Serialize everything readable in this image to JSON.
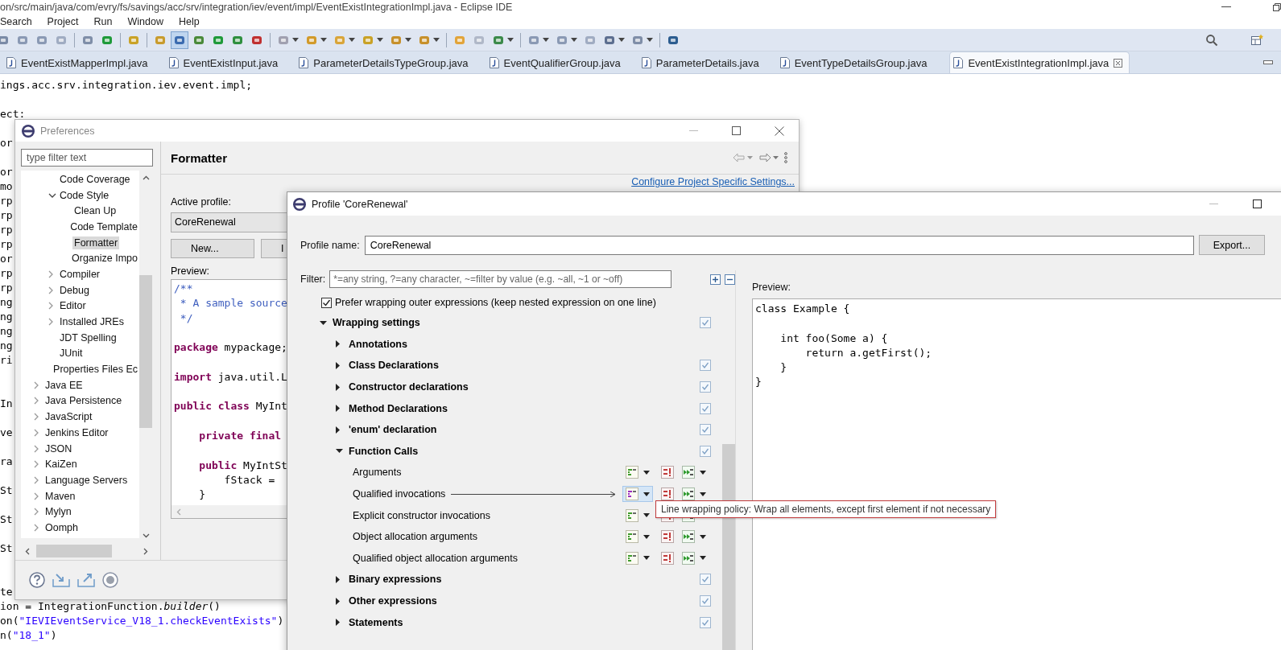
{
  "window": {
    "title": "on/src/main/java/com/evry/fs/savings/acc/srv/integration/iev/event/impl/EventExistIntegrationImpl.java - Eclipse IDE"
  },
  "menu": [
    "Search",
    "Project",
    "Run",
    "Window",
    "Help"
  ],
  "toolbar": [
    {
      "kind": "button",
      "pressed": false
    },
    {
      "kind": "button",
      "pressed": false
    },
    {
      "kind": "button",
      "pressed": false
    },
    {
      "kind": "button",
      "pressed": false
    },
    {
      "kind": "separator"
    },
    {
      "kind": "button",
      "pressed": false
    },
    {
      "kind": "button",
      "pressed": false
    },
    {
      "kind": "separator"
    },
    {
      "kind": "button",
      "pressed": false
    },
    {
      "kind": "separator"
    },
    {
      "kind": "button",
      "pressed": false
    },
    {
      "kind": "button",
      "pressed": true
    },
    {
      "kind": "button",
      "pressed": false
    },
    {
      "kind": "button",
      "pressed": false
    },
    {
      "kind": "button",
      "pressed": false
    },
    {
      "kind": "button",
      "pressed": false
    },
    {
      "kind": "separator"
    },
    {
      "kind": "menu-button",
      "pressed": false
    },
    {
      "kind": "menu-button",
      "pressed": false
    },
    {
      "kind": "menu-button",
      "pressed": false
    },
    {
      "kind": "menu-button",
      "pressed": false
    },
    {
      "kind": "menu-button",
      "pressed": false
    },
    {
      "kind": "menu-button",
      "pressed": false
    },
    {
      "kind": "separator"
    },
    {
      "kind": "button",
      "pressed": false
    },
    {
      "kind": "button",
      "pressed": false
    },
    {
      "kind": "menu-button",
      "pressed": false
    },
    {
      "kind": "separator"
    },
    {
      "kind": "menu-button",
      "pressed": false
    },
    {
      "kind": "menu-button",
      "pressed": false
    },
    {
      "kind": "button",
      "pressed": false
    },
    {
      "kind": "menu-button",
      "pressed": false
    },
    {
      "kind": "menu-button",
      "pressed": false
    },
    {
      "kind": "separator"
    },
    {
      "kind": "button",
      "pressed": false
    }
  ],
  "tabs": [
    {
      "label": "EventExistMapperImpl.java",
      "selected": false
    },
    {
      "label": "EventExistInput.java",
      "selected": false
    },
    {
      "label": "ParameterDetailsTypeGroup.java",
      "selected": false
    },
    {
      "label": "EventQualifierGroup.java",
      "selected": false
    },
    {
      "label": "ParameterDetails.java",
      "selected": false
    },
    {
      "label": "EventTypeDetailsGroup.java",
      "selected": false
    },
    {
      "label": "EventExistIntegrationImpl.java",
      "selected": true
    }
  ],
  "editor": {
    "lines": [
      {
        "kind": "code",
        "parts": [
          {
            "kind": "plain",
            "text": "ings.acc.srv.integration.iev.event.impl;"
          }
        ]
      },
      {
        "kind": "blank"
      },
      {
        "kind": "code",
        "parts": [
          {
            "kind": "plain",
            "text": "ect:"
          }
        ]
      },
      {
        "kind": "blank"
      },
      {
        "kind": "code",
        "parts": [
          {
            "kind": "plain",
            "text": "or"
          }
        ]
      },
      {
        "kind": "blank"
      },
      {
        "kind": "code",
        "parts": [
          {
            "kind": "plain",
            "text": "or"
          }
        ]
      },
      {
        "kind": "code",
        "parts": [
          {
            "kind": "plain",
            "text": "mo"
          }
        ]
      },
      {
        "kind": "code",
        "parts": [
          {
            "kind": "plain",
            "text": "rp"
          }
        ]
      },
      {
        "kind": "code",
        "parts": [
          {
            "kind": "plain",
            "text": "rp"
          }
        ]
      },
      {
        "kind": "code",
        "parts": [
          {
            "kind": "plain",
            "text": "rp"
          }
        ]
      },
      {
        "kind": "code",
        "parts": [
          {
            "kind": "plain",
            "text": "rp"
          }
        ]
      },
      {
        "kind": "code",
        "parts": [
          {
            "kind": "plain",
            "text": "or"
          }
        ]
      },
      {
        "kind": "code",
        "parts": [
          {
            "kind": "plain",
            "text": "rp"
          }
        ]
      },
      {
        "kind": "code",
        "parts": [
          {
            "kind": "plain",
            "text": "rp"
          }
        ]
      },
      {
        "kind": "code",
        "parts": [
          {
            "kind": "plain",
            "text": "ng"
          }
        ]
      },
      {
        "kind": "code",
        "parts": [
          {
            "kind": "plain",
            "text": "ng"
          }
        ]
      },
      {
        "kind": "code",
        "parts": [
          {
            "kind": "plain",
            "text": "ng"
          }
        ]
      },
      {
        "kind": "code",
        "parts": [
          {
            "kind": "plain",
            "text": "ng"
          }
        ]
      },
      {
        "kind": "code",
        "parts": [
          {
            "kind": "plain",
            "text": "ri"
          }
        ]
      },
      {
        "kind": "blank"
      },
      {
        "kind": "blank"
      },
      {
        "kind": "code",
        "parts": [
          {
            "kind": "plain",
            "text": "In"
          }
        ]
      },
      {
        "kind": "blank"
      },
      {
        "kind": "code",
        "parts": [
          {
            "kind": "plain",
            "text": "ve"
          }
        ]
      },
      {
        "kind": "blank"
      },
      {
        "kind": "code",
        "parts": [
          {
            "kind": "plain",
            "text": "ra"
          }
        ]
      },
      {
        "kind": "blank"
      },
      {
        "kind": "code",
        "parts": [
          {
            "kind": "plain",
            "text": "St"
          }
        ]
      },
      {
        "kind": "blank"
      },
      {
        "kind": "code",
        "parts": [
          {
            "kind": "plain",
            "text": "St"
          }
        ]
      },
      {
        "kind": "blank"
      },
      {
        "kind": "code",
        "parts": [
          {
            "kind": "plain",
            "text": "St"
          }
        ]
      },
      {
        "kind": "blank"
      },
      {
        "kind": "blank"
      },
      {
        "kind": "code",
        "parts": [
          {
            "kind": "plain",
            "text": "te"
          }
        ]
      },
      {
        "kind": "code",
        "parts": [
          {
            "kind": "plain",
            "text": "ion = IntegrationFunction."
          },
          {
            "kind": "italic",
            "text": "builder"
          },
          {
            "kind": "plain",
            "text": "()"
          }
        ]
      },
      {
        "kind": "code",
        "parts": [
          {
            "kind": "plain",
            "text": "on("
          },
          {
            "kind": "string",
            "text": "\"IEVIEventService_V18_1.checkEventExists\""
          },
          {
            "kind": "plain",
            "text": ")"
          }
        ]
      },
      {
        "kind": "code",
        "parts": [
          {
            "kind": "plain",
            "text": "n("
          },
          {
            "kind": "string",
            "text": "\"18_1\""
          },
          {
            "kind": "plain",
            "text": ")"
          }
        ]
      }
    ]
  },
  "preferences": {
    "title": "Preferences",
    "filter_placeholder": "type filter text",
    "tree": [
      {
        "children": [
          {
            "label": "Code Coverage",
            "selected": false
          },
          {
            "label": "Code Style",
            "expanded": true,
            "selected": false,
            "children": [
              {
                "label": "Clean Up",
                "selected": false
              },
              {
                "label": "Code Template",
                "selected": false
              },
              {
                "label": "Formatter",
                "selected": true
              },
              {
                "label": "Organize Impo",
                "selected": false
              }
            ]
          },
          {
            "label": "Compiler",
            "expanded": false,
            "selected": false
          },
          {
            "label": "Debug",
            "expanded": false,
            "selected": false
          },
          {
            "label": "Editor",
            "expanded": false,
            "selected": false
          },
          {
            "label": "Installed JREs",
            "expanded": false,
            "selected": false
          },
          {
            "label": "JDT Spelling",
            "selected": false
          },
          {
            "label": "JUnit",
            "selected": false
          },
          {
            "label": "Properties Files Ec",
            "selected": false
          }
        ]
      },
      {
        "label": "Java EE",
        "expanded": false,
        "selected": false
      },
      {
        "label": "Java Persistence",
        "expanded": false,
        "selected": false
      },
      {
        "label": "JavaScript",
        "expanded": false,
        "selected": false
      },
      {
        "label": "Jenkins Editor",
        "expanded": false,
        "selected": false
      },
      {
        "label": "JSON",
        "expanded": false,
        "selected": false
      },
      {
        "label": "KaiZen",
        "expanded": false,
        "selected": false
      },
      {
        "label": "Language Servers",
        "expanded": false,
        "selected": false
      },
      {
        "label": "Maven",
        "expanded": false,
        "selected": false
      },
      {
        "label": "Mylyn",
        "expanded": false,
        "selected": false
      },
      {
        "label": "Oomph",
        "expanded": false,
        "selected": false
      }
    ],
    "page_title": "Formatter",
    "link": "Configure Project Specific Settings...",
    "active_profile_label": "Active profile:",
    "active_profile": "CoreRenewal",
    "buttons": [
      "New...",
      "I"
    ],
    "preview_label": "Preview:",
    "preview_lines": [
      {
        "kind": "code",
        "parts": [
          {
            "kind": "comment",
            "text": "/**"
          }
        ]
      },
      {
        "kind": "code",
        "parts": [
          {
            "kind": "comment",
            "text": " * A sample source"
          }
        ]
      },
      {
        "kind": "code",
        "parts": [
          {
            "kind": "comment",
            "text": " */"
          }
        ]
      },
      {
        "kind": "blank"
      },
      {
        "kind": "code",
        "parts": [
          {
            "kind": "keyword",
            "text": "package"
          },
          {
            "kind": "plain",
            "text": " mypackage;"
          }
        ]
      },
      {
        "kind": "blank"
      },
      {
        "kind": "code",
        "parts": [
          {
            "kind": "keyword",
            "text": "import"
          },
          {
            "kind": "plain",
            "text": " java.util.L"
          }
        ]
      },
      {
        "kind": "blank"
      },
      {
        "kind": "code",
        "parts": [
          {
            "kind": "keyword",
            "text": "public class"
          },
          {
            "kind": "plain",
            "text": " MyInt"
          }
        ]
      },
      {
        "kind": "blank"
      },
      {
        "kind": "code",
        "parts": [
          {
            "kind": "keyword",
            "text": "    private final"
          }
        ]
      },
      {
        "kind": "blank"
      },
      {
        "kind": "code",
        "parts": [
          {
            "kind": "keyword",
            "text": "    public"
          },
          {
            "kind": "plain",
            "text": " MyIntSt"
          }
        ]
      },
      {
        "kind": "code",
        "parts": [
          {
            "kind": "plain",
            "text": "        fStack ="
          }
        ]
      },
      {
        "kind": "code",
        "parts": [
          {
            "kind": "plain",
            "text": "    }"
          }
        ]
      }
    ]
  },
  "profile_dialog": {
    "title": "Profile 'CoreRenewal'",
    "name_label": "Profile name:",
    "name": "CoreRenewal",
    "export_button": "Export...",
    "filter_label": "Filter:",
    "filter_placeholder": "*=any string, ?=any character, ~=filter by value (e.g. ~all, ~1 or ~off)",
    "prefer_option": {
      "label": "Prefer wrapping outer expressions (keep nested expression on one line)",
      "checked": true
    },
    "settings": [
      {
        "kind": "group",
        "label": "Wrapping settings",
        "expanded": true,
        "modified": true,
        "children": [
          {
            "kind": "group",
            "label": "Annotations",
            "expanded": false,
            "modified": false
          },
          {
            "kind": "group",
            "label": "Class Declarations",
            "expanded": false,
            "modified": true
          },
          {
            "kind": "group",
            "label": "Constructor declarations",
            "expanded": false,
            "modified": true
          },
          {
            "kind": "group",
            "label": "Method Declarations",
            "expanded": false,
            "modified": true
          },
          {
            "kind": "group",
            "label": "'enum' declaration",
            "expanded": false,
            "modified": true
          },
          {
            "kind": "group",
            "label": "Function Calls",
            "expanded": true,
            "modified": true,
            "children": [
              {
                "kind": "option",
                "label": "Arguments",
                "color": "#3d9a2a",
                "selected": false
              },
              {
                "kind": "option",
                "label": "Qualified invocations",
                "color": "#9b2fc0",
                "selected": true
              },
              {
                "kind": "option",
                "label": "Explicit constructor invocations",
                "color": "#3d9a2a",
                "selected": false
              },
              {
                "kind": "option",
                "label": "Object allocation arguments",
                "color": "#3d9a2a",
                "selected": false
              },
              {
                "kind": "option",
                "label": "Qualified object allocation arguments",
                "color": "#3d9a2a",
                "selected": false
              }
            ]
          },
          {
            "kind": "group",
            "label": "Binary expressions",
            "expanded": false,
            "modified": true
          },
          {
            "kind": "group",
            "label": "Other expressions",
            "expanded": false,
            "modified": true
          },
          {
            "kind": "group",
            "label": "Statements",
            "expanded": false,
            "modified": true
          }
        ]
      }
    ],
    "tooltip": "Line wrapping policy: Wrap all elements, except first element if not necessary",
    "preview_label": "Preview:",
    "preview_lines": [
      {
        "kind": "code",
        "parts": [
          {
            "kind": "plain",
            "text": "class Example {"
          }
        ]
      },
      {
        "kind": "blank"
      },
      {
        "kind": "code",
        "parts": [
          {
            "kind": "plain",
            "text": "    int foo(Some a) {"
          }
        ]
      },
      {
        "kind": "code",
        "parts": [
          {
            "kind": "plain",
            "text": "        return a.getFirst();"
          }
        ]
      },
      {
        "kind": "code",
        "parts": [
          {
            "kind": "plain",
            "text": "    }"
          }
        ]
      },
      {
        "kind": "code",
        "parts": [
          {
            "kind": "plain",
            "text": "}"
          }
        ]
      }
    ]
  }
}
